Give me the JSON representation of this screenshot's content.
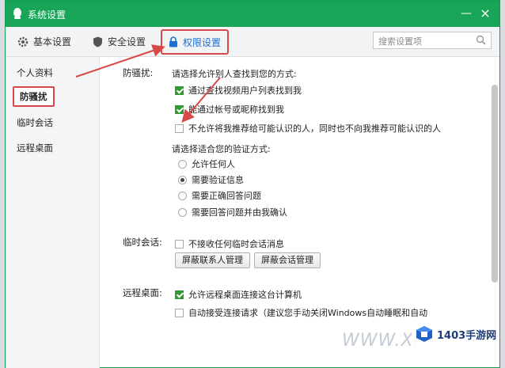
{
  "window": {
    "title": "系统设置",
    "minimize": "—",
    "close": "×"
  },
  "tabs": [
    {
      "label": "基本设置",
      "icon": "gear-icon"
    },
    {
      "label": "安全设置",
      "icon": "shield-icon"
    },
    {
      "label": "权限设置",
      "icon": "lock-icon"
    }
  ],
  "search": {
    "placeholder": "搜索设置项",
    "icon": "search-icon"
  },
  "sidebar": {
    "items": [
      "个人资料",
      "防骚扰",
      "临时会话",
      "远程桌面"
    ],
    "active_index": 1
  },
  "harass": {
    "label": "防骚扰:",
    "find_title": "请选择允许别人查找到您的方式:",
    "find_options": [
      {
        "label": "通过查找视频用户列表找到我",
        "checked": true
      },
      {
        "label": "能通过帐号或昵称找到我",
        "checked": true
      },
      {
        "label": "不允许将我推荐给可能认识的人，同时也不向我推荐可能认识的人",
        "checked": false
      }
    ],
    "verify_title": "请选择适合您的验证方式:",
    "verify_options": [
      {
        "label": "允许任何人",
        "selected": false
      },
      {
        "label": "需要验证信息",
        "selected": true
      },
      {
        "label": "需要正确回答问题",
        "selected": false
      },
      {
        "label": "需要回答问题并由我确认",
        "selected": false
      }
    ]
  },
  "temp_session": {
    "label": "临时会话:",
    "option": {
      "label": "不接收任何临时会话消息",
      "checked": false
    },
    "buttons": [
      "屏蔽联系人管理",
      "屏蔽会话管理"
    ]
  },
  "remote": {
    "label": "远程桌面:",
    "options": [
      {
        "label": "允许远程桌面连接这台计算机",
        "checked": true
      },
      {
        "label": "自动接受连接请求（建议您手动关闭Windows自动睡眠和自动",
        "checked": false
      }
    ]
  },
  "watermark": {
    "text": "WWW.XI",
    "brand": "1403手游网"
  },
  "colors": {
    "title_bar": "#18a557",
    "highlight": "#d94848",
    "active_tab": "#1e6fd1",
    "checkbox_on": "#2e9a34"
  }
}
